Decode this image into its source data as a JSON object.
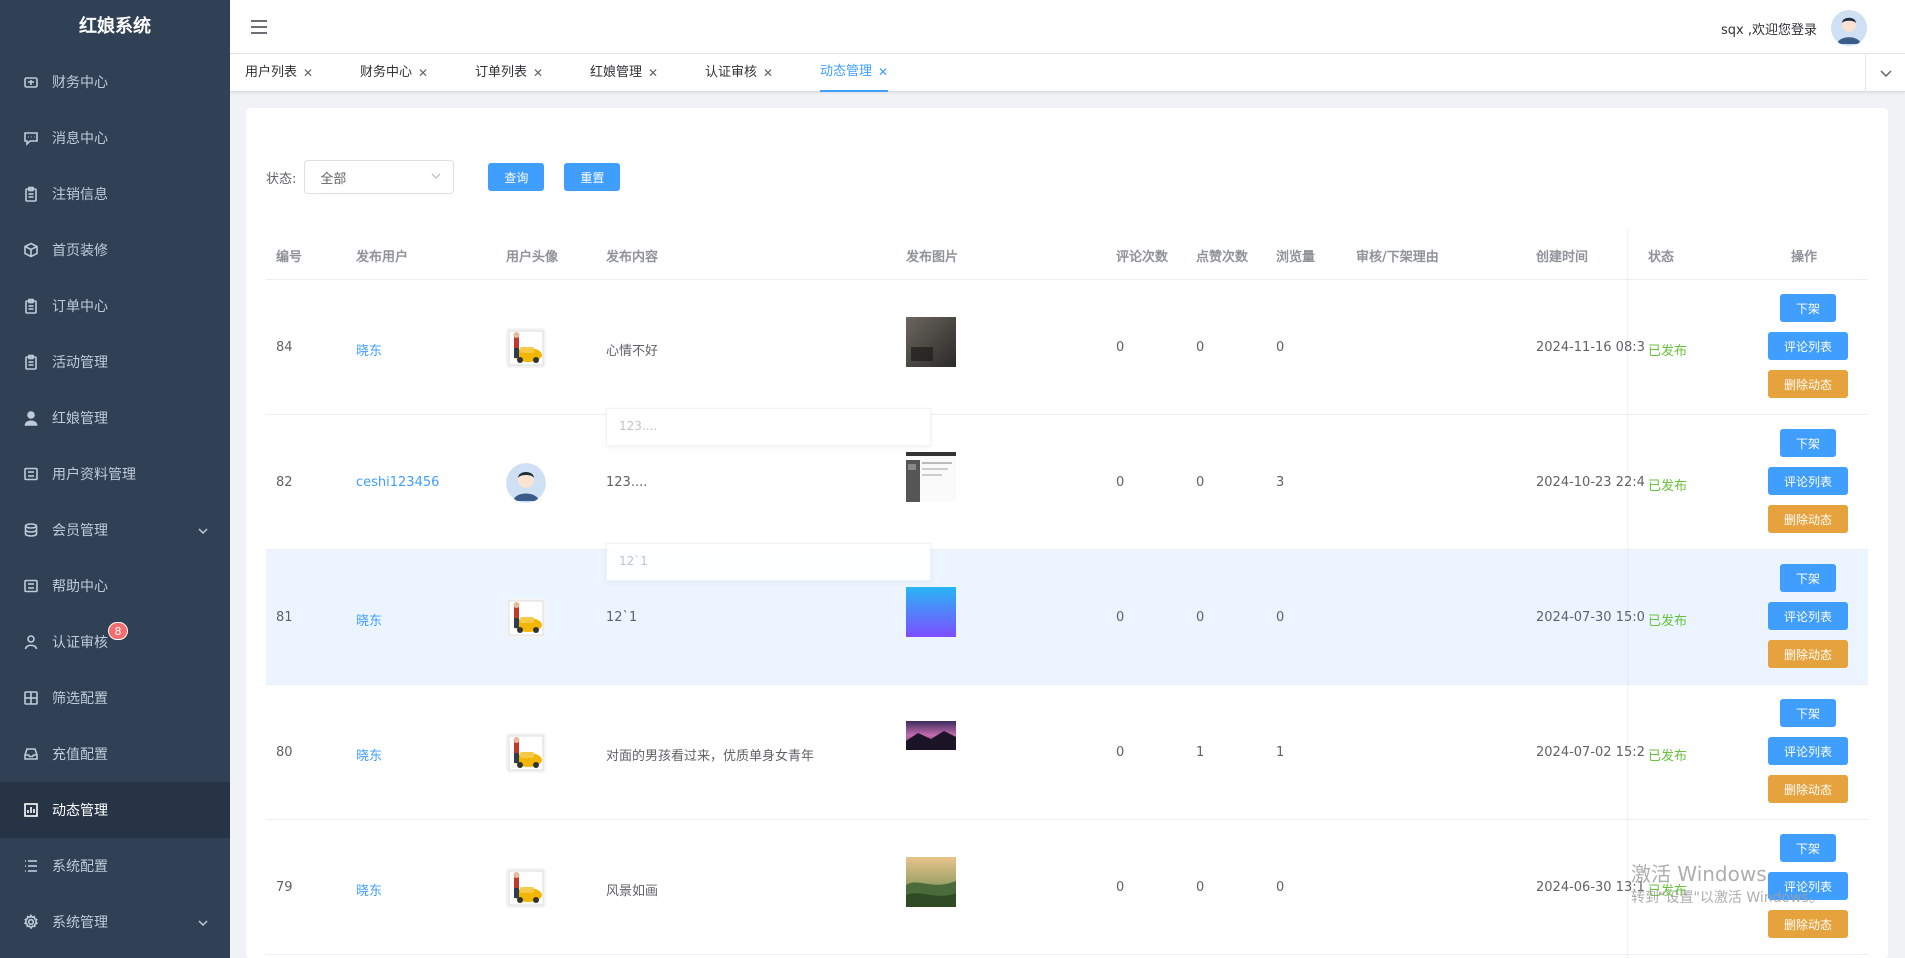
{
  "app": {
    "title": "红娘系统"
  },
  "sidebar": {
    "items": [
      {
        "label": "财务中心",
        "icon": "wallet-icon"
      },
      {
        "label": "消息中心",
        "icon": "message-icon"
      },
      {
        "label": "注销信息",
        "icon": "clipboard-icon"
      },
      {
        "label": "首页装修",
        "icon": "cube-icon"
      },
      {
        "label": "订单中心",
        "icon": "clipboard-icon"
      },
      {
        "label": "活动管理",
        "icon": "clipboard-icon"
      },
      {
        "label": "红娘管理",
        "icon": "person-icon"
      },
      {
        "label": "用户资料管理",
        "icon": "list-icon"
      },
      {
        "label": "会员管理",
        "icon": "database-icon",
        "expandable": true
      },
      {
        "label": "帮助中心",
        "icon": "list-icon"
      },
      {
        "label": "认证审核",
        "icon": "user-icon",
        "badge": "8"
      },
      {
        "label": "筛选配置",
        "icon": "grid-icon"
      },
      {
        "label": "充值配置",
        "icon": "inbox-icon"
      },
      {
        "label": "动态管理",
        "icon": "chart-icon",
        "active": true
      },
      {
        "label": "系统配置",
        "icon": "menu-icon"
      },
      {
        "label": "系统管理",
        "icon": "gear-icon",
        "expandable": true
      }
    ]
  },
  "header": {
    "welcome": "sqx ,欢迎您登录"
  },
  "tabs": [
    {
      "label": "用户列表"
    },
    {
      "label": "财务中心"
    },
    {
      "label": "订单列表"
    },
    {
      "label": "红娘管理"
    },
    {
      "label": "认证审核"
    },
    {
      "label": "动态管理",
      "active": true
    }
  ],
  "filter": {
    "label": "状态:",
    "value": "全部",
    "query": "查询",
    "reset": "重置"
  },
  "table": {
    "columns": [
      "编号",
      "发布用户",
      "用户头像",
      "发布内容",
      "发布图片",
      "评论次数",
      "点赞次数",
      "浏览量",
      "审核/下架理由",
      "创建时间",
      "状态",
      "操作"
    ],
    "rows": [
      {
        "id": "84",
        "user": "晓东",
        "content": "心情不好",
        "comments": "0",
        "likes": "0",
        "views": "0",
        "reason": "",
        "created": "2024-11-16 08:3",
        "status": "已发布",
        "avatar": "car",
        "thumb": "dark"
      },
      {
        "id": "82",
        "user": "ceshi123456",
        "content": "123....",
        "comments": "0",
        "likes": "0",
        "views": "3",
        "reason": "",
        "created": "2024-10-23 22:4",
        "status": "已发布",
        "avatar": "person",
        "thumb": "screen"
      },
      {
        "id": "81",
        "user": "晓东",
        "content": "12`1",
        "comments": "0",
        "likes": "0",
        "views": "0",
        "reason": "",
        "created": "2024-07-30 15:0",
        "status": "已发布",
        "avatar": "car",
        "thumb": "gradient"
      },
      {
        "id": "80",
        "user": "晓东",
        "content": "对面的男孩看过来，优质单身女青年",
        "comments": "0",
        "likes": "1",
        "views": "1",
        "reason": "",
        "created": "2024-07-02 15:2",
        "status": "已发布",
        "avatar": "car",
        "thumb": "sunset"
      },
      {
        "id": "79",
        "user": "晓东",
        "content": "风景如画",
        "comments": "0",
        "likes": "0",
        "views": "0",
        "reason": "",
        "created": "2024-06-30 13:1",
        "status": "已发布",
        "avatar": "car",
        "thumb": "landscape"
      }
    ],
    "actions": {
      "down": "下架",
      "comments": "评论列表",
      "delete": "删除动态"
    }
  },
  "tooltips": [
    "123....",
    "12`1"
  ],
  "watermark": {
    "line1": "激活 Windows",
    "line2": "转到\"设置\"以激活 Windows。"
  }
}
